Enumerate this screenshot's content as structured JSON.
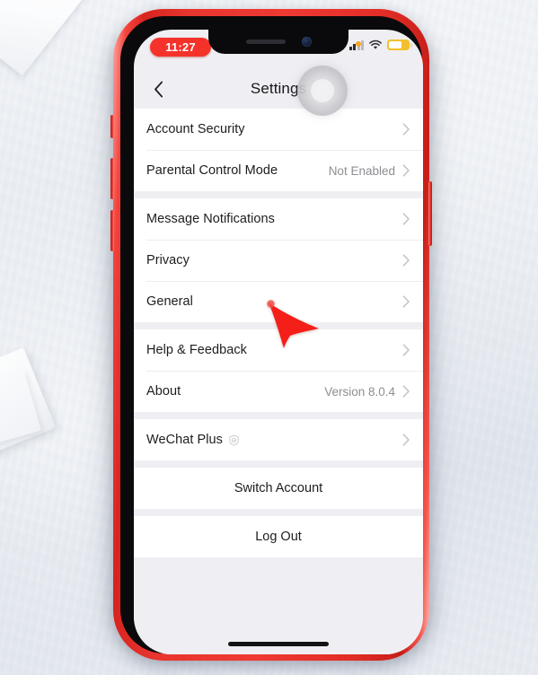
{
  "device": {
    "frame_color": "#e8352e",
    "bezel_color": "#0a0a0c",
    "screen_bg": "#efeff3"
  },
  "status_bar": {
    "time": "11:27",
    "time_pill_color": "#f5322a",
    "recording_indicator": true,
    "mic_indicator": "mic-dot-icon",
    "cellular": "cellular-bars-icon",
    "wifi": "wifi-icon",
    "battery": "battery-icon",
    "battery_color": "#f3bf2e"
  },
  "nav": {
    "back": "back-chevron-icon",
    "title": "Settings"
  },
  "overlay": {
    "assistive_touch": "assistive-touch-button",
    "cursor": "red-arrow-cursor"
  },
  "groups": [
    {
      "rows": [
        {
          "label": "Account Security",
          "value": "",
          "badge": "",
          "chevron": true
        },
        {
          "label": "Parental Control Mode",
          "value": "Not Enabled",
          "badge": "",
          "chevron": true
        }
      ]
    },
    {
      "rows": [
        {
          "label": "Message Notifications",
          "value": "",
          "badge": "",
          "chevron": true
        },
        {
          "label": "Privacy",
          "value": "",
          "badge": "",
          "chevron": true
        },
        {
          "label": "General",
          "value": "",
          "badge": "",
          "chevron": true
        }
      ]
    },
    {
      "rows": [
        {
          "label": "Help & Feedback",
          "value": "",
          "badge": "",
          "chevron": true
        },
        {
          "label": "About",
          "value": "Version 8.0.4",
          "badge": "",
          "chevron": true
        }
      ]
    },
    {
      "rows": [
        {
          "label": "WeChat Plus",
          "value": "",
          "badge": "shield-badge-icon",
          "chevron": true
        }
      ]
    }
  ],
  "actions": {
    "switch_account": "Switch Account",
    "log_out": "Log Out"
  },
  "home_indicator": "home-indicator"
}
